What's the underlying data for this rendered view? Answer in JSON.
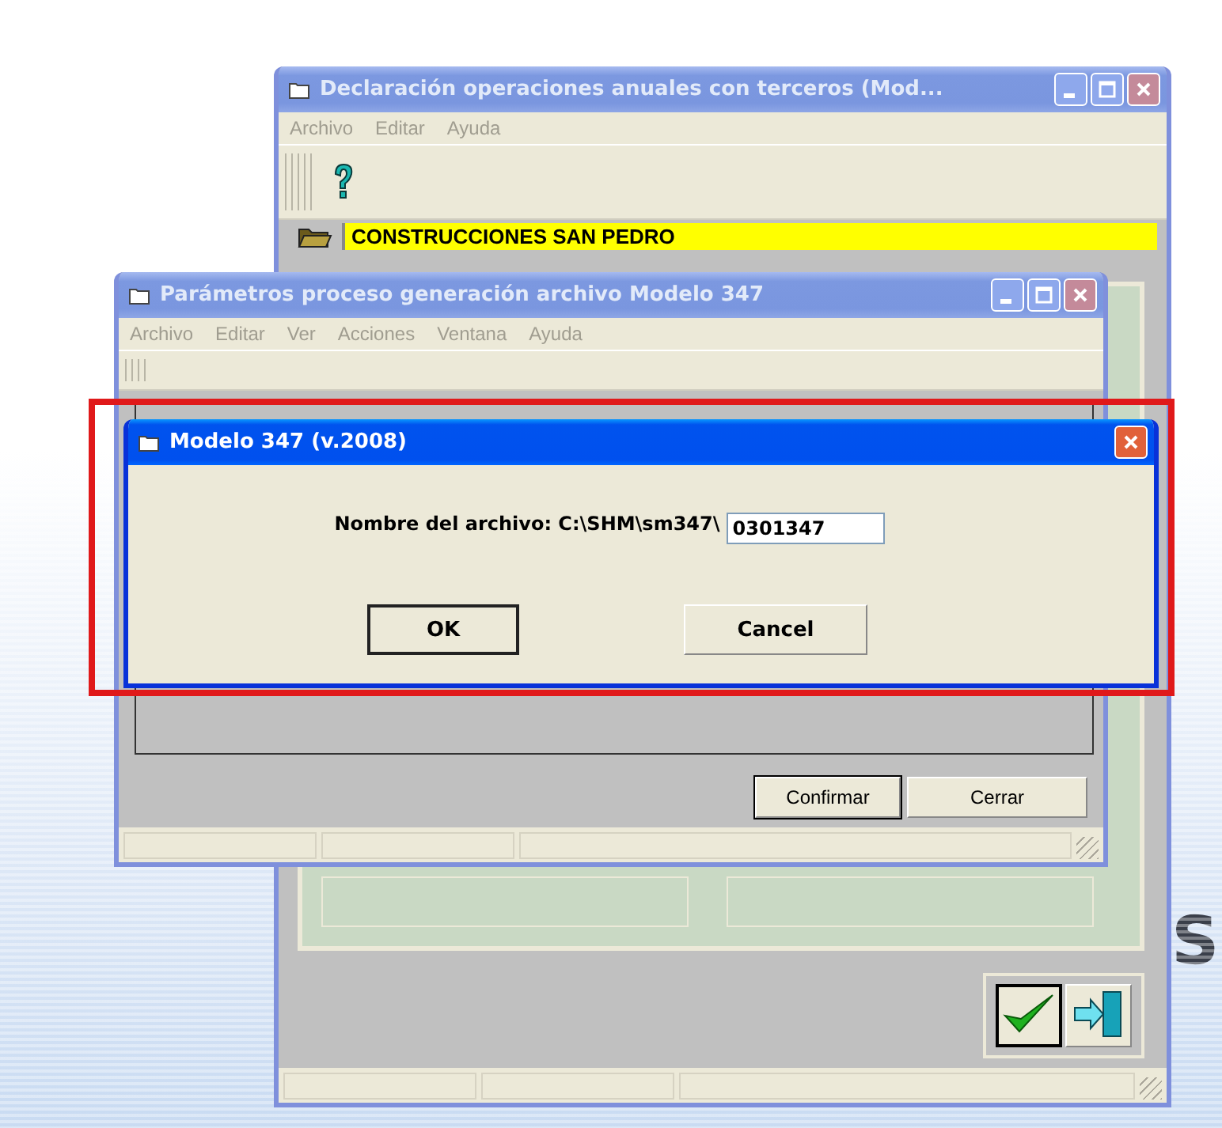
{
  "windows": [
    {
      "kind": "main",
      "title": "Declaración operaciones anuales con terceros (Mod...",
      "active": false,
      "minimizable": true,
      "maximizable": true,
      "menu": [
        "Archivo",
        "Editar",
        "Ayuda"
      ],
      "company": "CONSTRUCCIONES SAN PEDRO"
    },
    {
      "kind": "params",
      "title": "Parámetros proceso generación archivo Modelo 347",
      "active": false,
      "minimizable": true,
      "maximizable": true,
      "menu": [
        "Archivo",
        "Editar",
        "Ver",
        "Acciones",
        "Ventana",
        "Ayuda"
      ],
      "buttons": [
        {
          "label": "Confirmar",
          "default": true
        },
        {
          "label": "Cerrar",
          "default": false
        }
      ]
    },
    {
      "kind": "dialog",
      "title": "Modelo 347 (v.2008)",
      "active": true,
      "minimizable": false,
      "maximizable": false,
      "field": {
        "label": "Nombre del archivo: C:\\SHM\\sm347\\",
        "value": "0301347"
      },
      "buttons": [
        {
          "label": "OK",
          "default": true
        },
        {
          "label": "Cancel",
          "default": false
        }
      ]
    }
  ],
  "logo_letter": "S"
}
